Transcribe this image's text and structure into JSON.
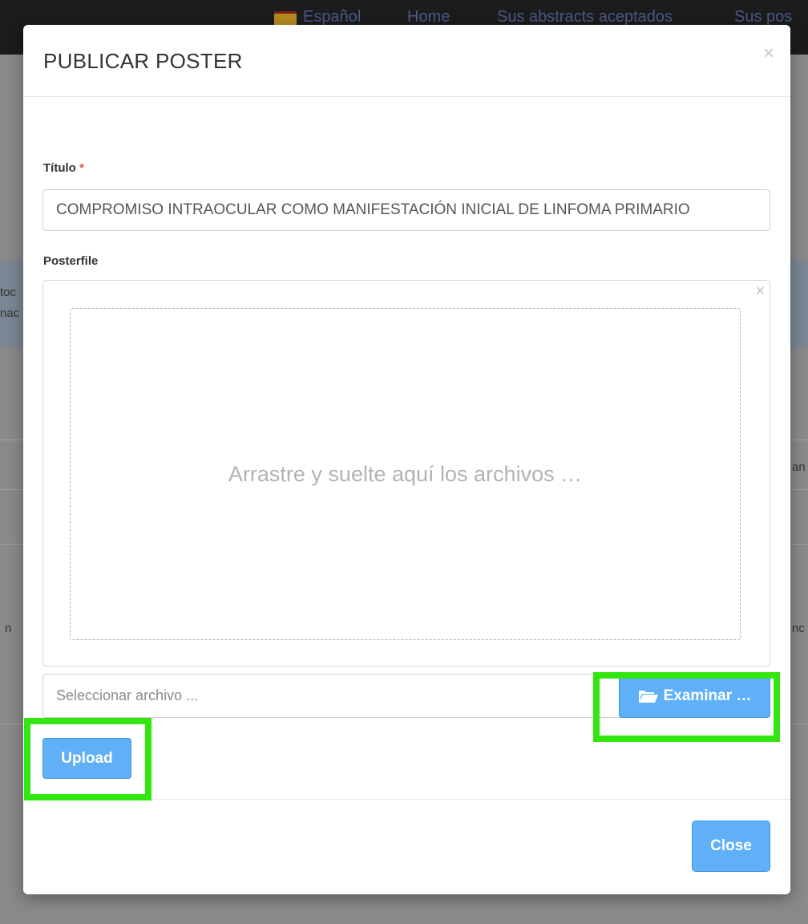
{
  "background": {
    "nav": {
      "language": "Español",
      "links": [
        "Home",
        "Sus abstracts aceptados",
        "Sus pos"
      ]
    },
    "fragments": [
      "toc",
      "nac",
      "an",
      "n",
      "nc"
    ]
  },
  "modal": {
    "title": "PUBLICAR POSTER",
    "close_symbol": "×",
    "title_field": {
      "label": "Título",
      "required_mark": "*",
      "value": "COMPROMISO INTRAOCULAR COMO MANIFESTACIÓN INICIAL DE LINFOMA PRIMARIO"
    },
    "posterfile": {
      "label": "Posterfile",
      "remove_symbol": "×",
      "dropzone_text": "Arrastre y suelte aquí los archivos …",
      "caption_placeholder": "Seleccionar archivo ...",
      "browse_label": "Examinar …",
      "browse_icon": "folder-open-icon"
    },
    "upload_label": "Upload",
    "footer_close_label": "Close"
  },
  "colors": {
    "button_primary": "#5fb0f7",
    "highlight": "#33e60f",
    "required": "#d9534f"
  },
  "highlights": [
    "browse-button",
    "upload-button"
  ]
}
